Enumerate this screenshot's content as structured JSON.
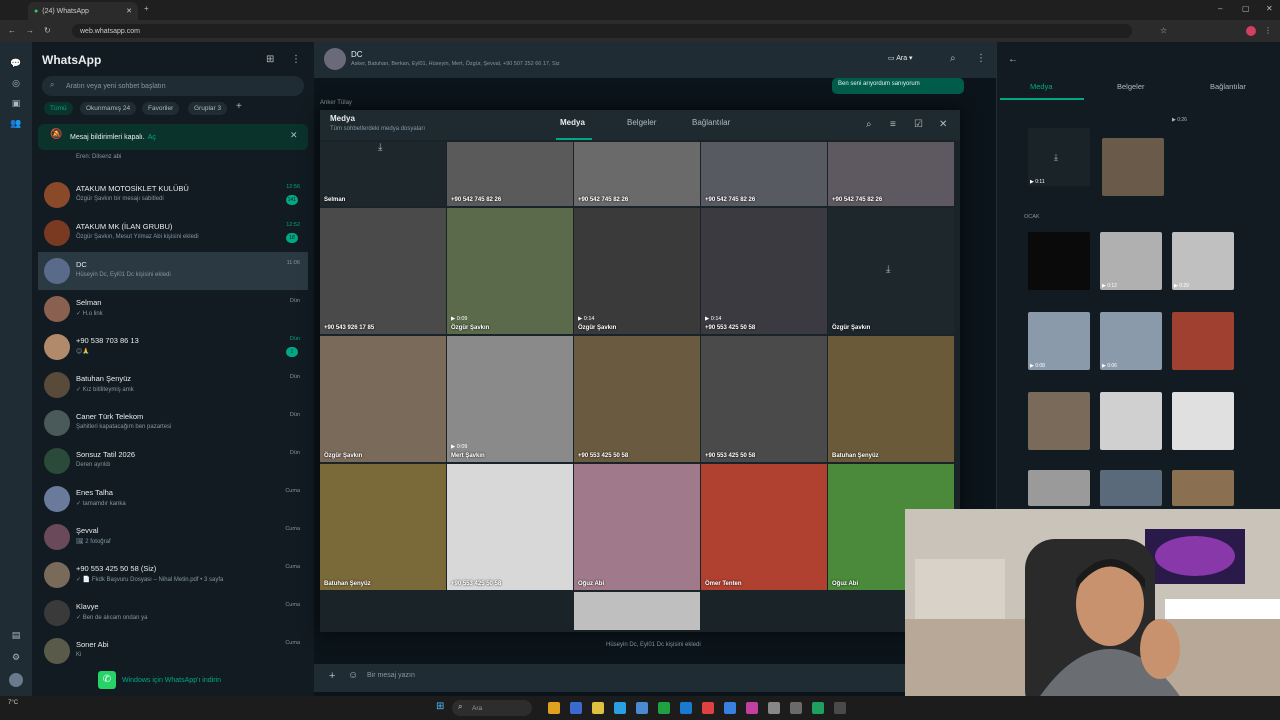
{
  "browser": {
    "tab_title": "(24) WhatsApp",
    "url": "web.whatsapp.com"
  },
  "sidebar": {
    "title": "WhatsApp",
    "search_placeholder": "Aratın veya yeni sohbet başlatın",
    "filters": [
      "Tümü",
      "Okunmamış 24",
      "Favoriler",
      "Gruplar 3"
    ],
    "notice": "Mesaj bildirimleri kapalı.",
    "notice_link": "Aç",
    "chats": [
      {
        "name": "Eren: Dilsenz abi",
        "preview": "",
        "time": "",
        "badge": ""
      },
      {
        "name": "ATAKUM MOTOSİKLET KULÜBÜ",
        "preview": "Özgür Şavkın bir mesajı sabitledi",
        "time": "12:56",
        "badge": "141",
        "color": "#8a4a2a"
      },
      {
        "name": "ATAKUM MK (İLAN GRUBU)",
        "preview": "Özgür Şavkın, Mesut Yılmaz Abi kişisini ekledi",
        "time": "12:52",
        "badge": "18",
        "color": "#7a3a22"
      },
      {
        "name": "DC",
        "preview": "Hüseyin Dc, Eyl01 Dc kişisini ekledi",
        "time": "11:06",
        "badge": "",
        "color": "#5a6a8a"
      },
      {
        "name": "Selman",
        "preview": "✓ H.o link",
        "time": "Dün",
        "badge": "",
        "color": "#8a6050"
      },
      {
        "name": "+90 538 703 86 13",
        "preview": "😊🙏",
        "time": "Dün",
        "badge": "1",
        "color": "#b08a6a"
      },
      {
        "name": "Batuhan Şenyüz",
        "preview": "✓ Kız bitiliteymiş amk",
        "time": "Dün",
        "badge": "",
        "color": "#5a4a3a"
      },
      {
        "name": "Caner Türk Telekom",
        "preview": "Şahitleri kapatacağım ben pazartesi",
        "time": "Dün",
        "badge": "",
        "color": "#4a5a5a"
      },
      {
        "name": "Sonsuz Tatil 2026",
        "preview": "Deren ayrıldı",
        "time": "Dün",
        "badge": "",
        "color": "#2a4a3a"
      },
      {
        "name": "Enes Talha",
        "preview": "✓ tamamdır kanka",
        "time": "Cuma",
        "badge": "",
        "color": "#6a7a9a"
      },
      {
        "name": "Şevval",
        "preview": "🖼 2 fotoğraf",
        "time": "Cuma",
        "badge": "",
        "color": "#6a4a5a"
      },
      {
        "name": "+90 553 425 50 58 (Siz)",
        "preview": "✓ 📄 Fkdk Başvuru Dosyası – Nihal Metin.pdf • 3 sayfa",
        "time": "Cuma",
        "badge": "",
        "color": "#7a6a5a"
      },
      {
        "name": "Klavye",
        "preview": "✓ Ben de alıcam ondan ya",
        "time": "Cuma",
        "badge": "",
        "color": "#3a3a3a"
      },
      {
        "name": "Soner Abi",
        "preview": "Ki",
        "time": "Cuma",
        "badge": "",
        "color": "#5a5a4a"
      }
    ],
    "download_label": "Windows için WhatsApp'ı indirin"
  },
  "chat": {
    "title": "DC",
    "members": "Asker, Batuhan, Berkan, Eyl01, Hüseyin, Mert, Özgür, Şevval, +90 507 252 66 17, Siz",
    "call_label": "Ara",
    "bubble_text": "Ben seni arıyordum sanıyorum",
    "bubble_time": "23:56",
    "sender_label": "Anker Tülay",
    "system_note": "Hüseyin Dc, Eyl01 Dc kişisini ekledi",
    "message_placeholder": "Bir mesaj yazın"
  },
  "media_modal": {
    "title": "Medya",
    "subtitle": "Tüm sohbetlerdeki medya dosyaları",
    "tabs": [
      "Medya",
      "Belgeler",
      "Bağlantılar"
    ],
    "tiles": [
      {
        "caption": "Selman",
        "duration": "",
        "color": "#1e272c"
      },
      {
        "caption": "+90 542 745 82 26",
        "duration": "",
        "color": "#5a5a5a"
      },
      {
        "caption": "+90 542 745 82 26",
        "duration": "",
        "color": "#6a6a6a"
      },
      {
        "caption": "+90 542 745 82 26",
        "duration": "",
        "color": "#585a62"
      },
      {
        "caption": "+90 542 745 82 26",
        "duration": "",
        "color": "#5e5860"
      },
      {
        "caption": "+90 543 926 17 85",
        "duration": "",
        "color": "#4a4a4a"
      },
      {
        "caption": "Özgür Şavkın",
        "duration": "0:09",
        "color": "#5a6a4a"
      },
      {
        "caption": "Özgür Şavkın",
        "duration": "0:14",
        "color": "#3a3a3a"
      },
      {
        "caption": "+90 553 425 50 58",
        "duration": "0:14",
        "color": "#3a3a40"
      },
      {
        "caption": "Özgür Şavkın",
        "duration": "",
        "color": "#1e272c"
      },
      {
        "caption": "Özgür Şavkın",
        "duration": "",
        "color": "#7a6a5a"
      },
      {
        "caption": "Mert Şavkın",
        "duration": "0:09",
        "color": "#8a8a8a"
      },
      {
        "caption": "+90 553 425 50 58",
        "duration": "",
        "color": "#6a5a40"
      },
      {
        "caption": "+90 553 425 50 58",
        "duration": "",
        "color": "#4a4a4a"
      },
      {
        "caption": "Batuhan Şenyüz",
        "duration": "",
        "color": "#6a5a3a"
      },
      {
        "caption": "Batuhan Şenyüz",
        "duration": "",
        "color": "#7a6a3a"
      },
      {
        "caption": "+90 553 425 50 58",
        "duration": "",
        "color": "#d8d8d8"
      },
      {
        "caption": "Oğuz Abi",
        "duration": "",
        "color": "#a07a8a"
      },
      {
        "caption": "Ömer Tenten",
        "duration": "",
        "color": "#b04030"
      },
      {
        "caption": "Oğuz Abi",
        "duration": "",
        "color": "#4a8a3a"
      },
      {
        "caption": "",
        "duration": "",
        "color": "#bfbfbf"
      }
    ]
  },
  "right_panel": {
    "tabs": [
      "Medya",
      "Belgeler",
      "Bağlantılar"
    ],
    "section_label": "OCAK",
    "durations": [
      "0:11",
      "0:26",
      "0:12",
      "0:29",
      "0:08",
      "0:06"
    ]
  },
  "taskbar": {
    "search_placeholder": "Ara",
    "weather": "7°C"
  },
  "colors": {
    "accent": "#00a884",
    "panel": "#111b21",
    "header": "#202c33"
  }
}
